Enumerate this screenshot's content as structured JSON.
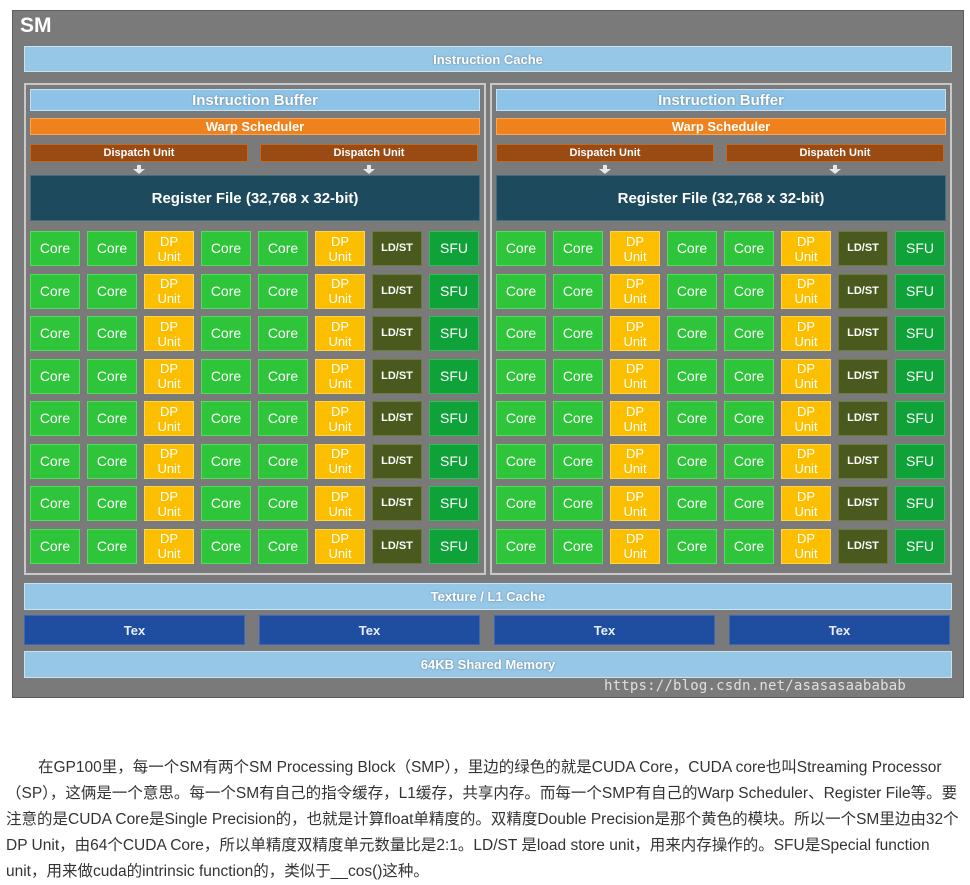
{
  "diagram": {
    "sm_label": "SM",
    "instruction_cache": "Instruction Cache",
    "blocks": [
      {
        "instruction_buffer": "Instruction Buffer",
        "warp_scheduler": "Warp Scheduler",
        "dispatch_units": [
          "Dispatch Unit",
          "Dispatch Unit"
        ],
        "register_file": "Register File (32,768 x 32-bit)"
      },
      {
        "instruction_buffer": "Instruction Buffer",
        "warp_scheduler": "Warp Scheduler",
        "dispatch_units": [
          "Dispatch Unit",
          "Dispatch Unit"
        ],
        "register_file": "Register File (32,768 x 32-bit)"
      }
    ],
    "row_cells": [
      {
        "type": "core",
        "label": "Core"
      },
      {
        "type": "core",
        "label": "Core"
      },
      {
        "type": "dp",
        "label": "DP\nUnit"
      },
      {
        "type": "core",
        "label": "Core"
      },
      {
        "type": "core",
        "label": "Core"
      },
      {
        "type": "dp",
        "label": "DP\nUnit"
      },
      {
        "type": "ldst",
        "label": "LD/ST"
      },
      {
        "type": "sfu",
        "label": "SFU"
      }
    ],
    "rows_per_block": 8,
    "texture_l1_cache": "Texture / L1 Cache",
    "tex_units": [
      "Tex",
      "Tex",
      "Tex",
      "Tex"
    ],
    "shared_memory": "64KB Shared Memory",
    "watermark": "https://blog.csdn.net/asasasaababab",
    "colors": {
      "core": "#2fc53a",
      "dp_unit": "#fbbf00",
      "ldst": "#4a5a1e",
      "sfu": "#0ea238",
      "warp_scheduler": "#f0821e",
      "dispatch_unit": "#9a4b14",
      "register_file": "#1d4a5c",
      "cache": "#97c7e7",
      "tex": "#1f4ea0"
    }
  },
  "caption": "在GP100里，每一个SM有两个SM Processing Block（SMP），里边的绿色的就是CUDA Core，CUDA core也叫Streaming Processor（SP），这俩是一个意思。每一个SM有自己的指令缓存，L1缓存，共享内存。而每一个SMP有自己的Warp Scheduler、Register File等。要注意的是CUDA Core是Single Precision的，也就是计算float单精度的。双精度Double Precision是那个黄色的模块。所以一个SM里边由32个DP Unit，由64个CUDA Core，所以单精度双精度单元数量比是2:1。LD/ST 是load store unit，用来内存操作的。SFU是Special function unit，用来做cuda的intrinsic function的，类似于__cos()这种。"
}
